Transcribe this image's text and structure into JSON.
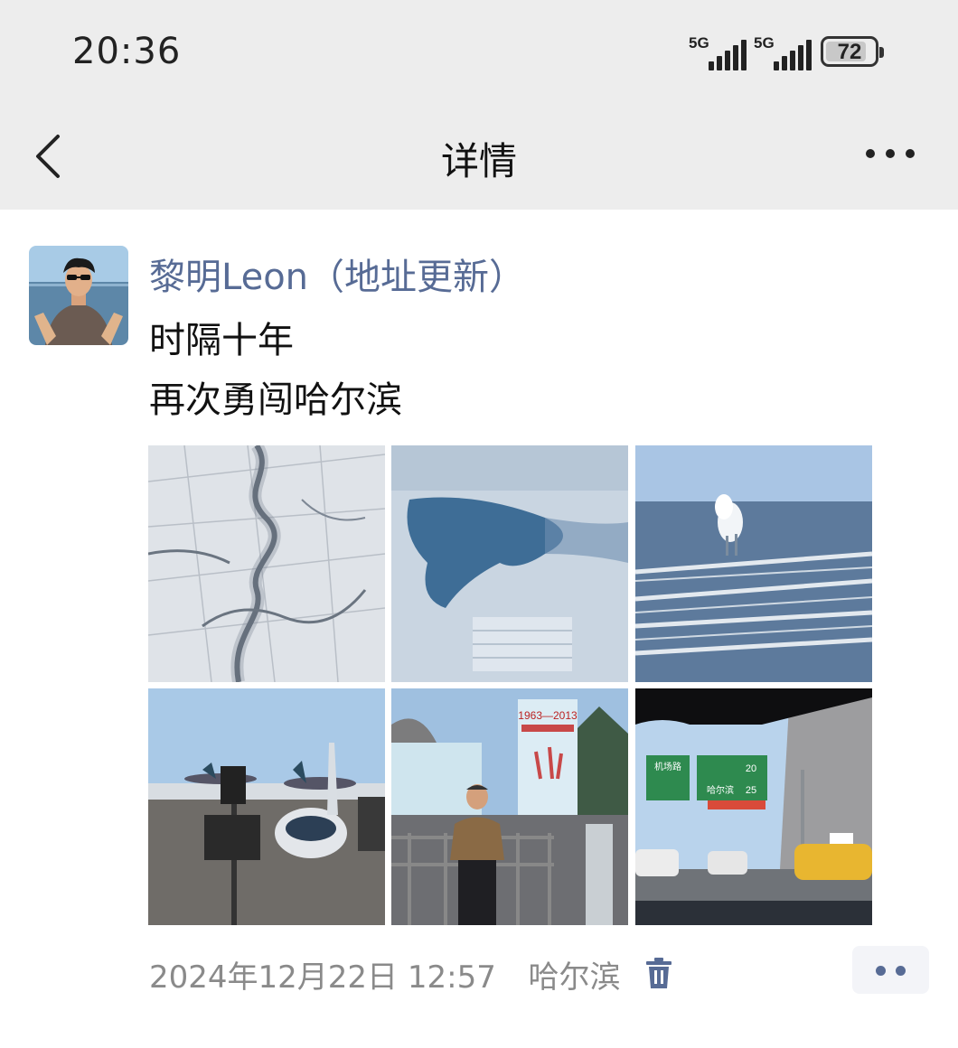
{
  "status_bar": {
    "time": "20:36",
    "signal_1": "5G",
    "signal_2": "5G",
    "battery_percent": "72"
  },
  "nav": {
    "title": "详情",
    "back_icon": "chevron-left-icon",
    "more_icon": "more-horizontal-icon"
  },
  "post": {
    "author": "黎明Leon（地址更新）",
    "text_lines": [
      "时隔十年",
      "再次勇闯哈尔滨"
    ],
    "photos": [
      "aerial frozen river winding through snowy fields",
      "aerial frozen lake with blue water",
      "aerial snowy plain with steam plumes",
      "airplane at airport gate",
      "person in front of ice sculpture 1963-2013",
      "highway road signs from car window"
    ],
    "timestamp": "2024年12月22日 12:57",
    "location": "哈尔滨",
    "delete_icon": "trash-icon",
    "action_icon": "two-dots-icon"
  },
  "photo_texts": {
    "ice_sign": "1963—2013",
    "road_sign_1": "机场路",
    "road_sign_2": "哈尔滨",
    "road_sign_dist_1": "20",
    "road_sign_dist_2": "25"
  },
  "colors": {
    "header_bg": "#ededed",
    "link_blue": "#576b95",
    "meta_gray": "#8a8a8a",
    "accent": "#576b95"
  }
}
